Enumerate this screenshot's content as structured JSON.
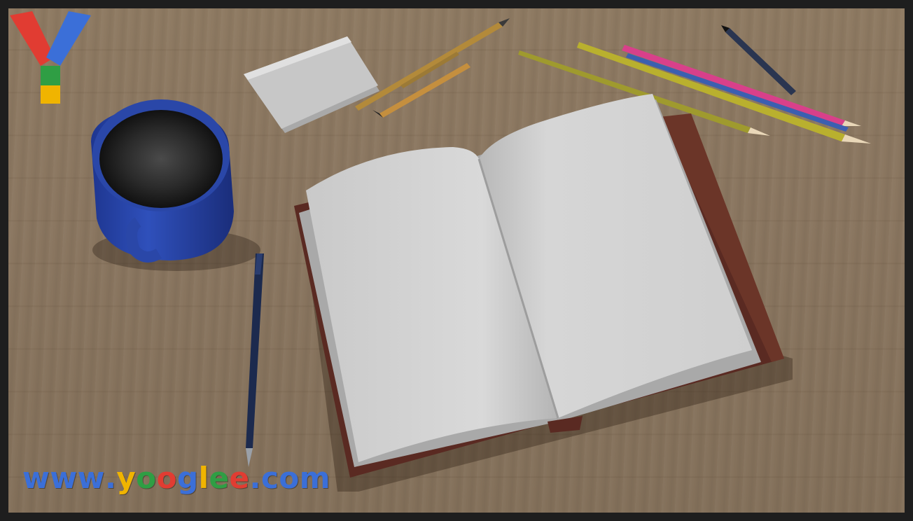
{
  "scene": {
    "objects": [
      "blue-mug",
      "open-notebook",
      "pen",
      "pencils",
      "paper-stack"
    ]
  },
  "watermark": {
    "url_text": "www.yooglee.com",
    "letter_colors": [
      "#3b6fd8",
      "#3b6fd8",
      "#3b6fd8",
      "#3b6fd8",
      "#f0b400",
      "#2f9e44",
      "#e13c32",
      "#3b6fd8",
      "#f0b400",
      "#2f9e44",
      "#e13c32",
      "#3b6fd8",
      "#3b6fd8",
      "#3b6fd8",
      "#3b6fd8"
    ],
    "logo_letter": "Y",
    "logo_colors": {
      "left": "#e13c32",
      "right": "#3b6fd8",
      "stem_top": "#2f9e44",
      "stem_bottom": "#f0b400"
    }
  },
  "colors": {
    "desk": "#8a7660",
    "mug": "#2a47a8",
    "notebook_cover": "#5a2a22",
    "page": "#d8d8d8"
  }
}
